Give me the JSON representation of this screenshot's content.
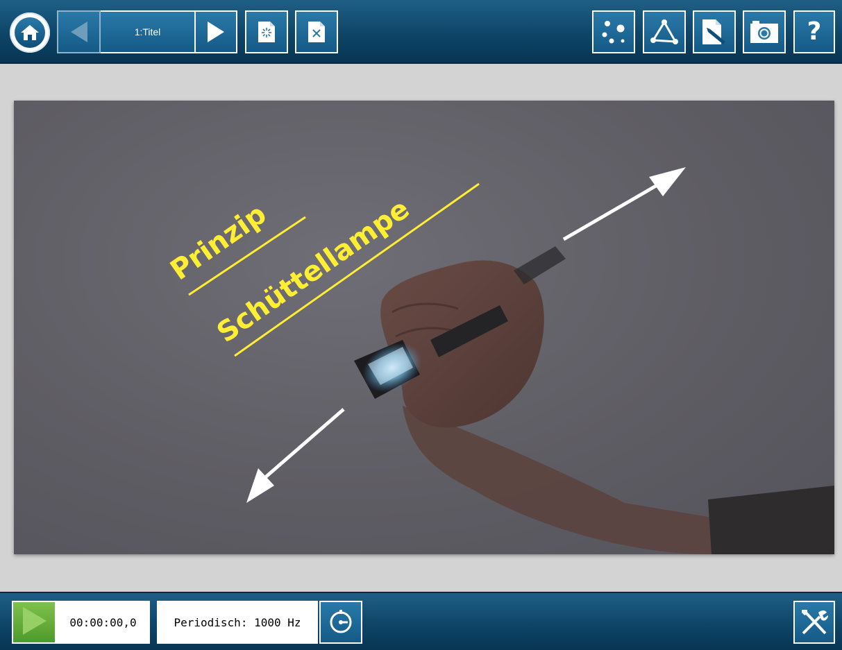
{
  "toolbar": {
    "page_label": "1:Titel",
    "icons": {
      "home": "home-icon",
      "prev": "arrow-left-icon",
      "next": "arrow-right-icon",
      "new_page": "new-page-icon",
      "close_page": "close-page-icon",
      "points": "points-icon",
      "triangle": "triangle-tool-icon",
      "annotate": "pen-annotate-icon",
      "camera": "camera-icon",
      "help": "help-icon"
    },
    "help_label": "?"
  },
  "slide": {
    "title_line1": "Prinzip",
    "title_line2": "Schüttellampe",
    "title_color": "#ffee33"
  },
  "status": {
    "time": "00:00:00,0",
    "mode": "Periodisch: 1000 Hz",
    "icons": {
      "play": "play-icon",
      "trigger": "trigger-icon",
      "settings": "tools-icon"
    }
  }
}
